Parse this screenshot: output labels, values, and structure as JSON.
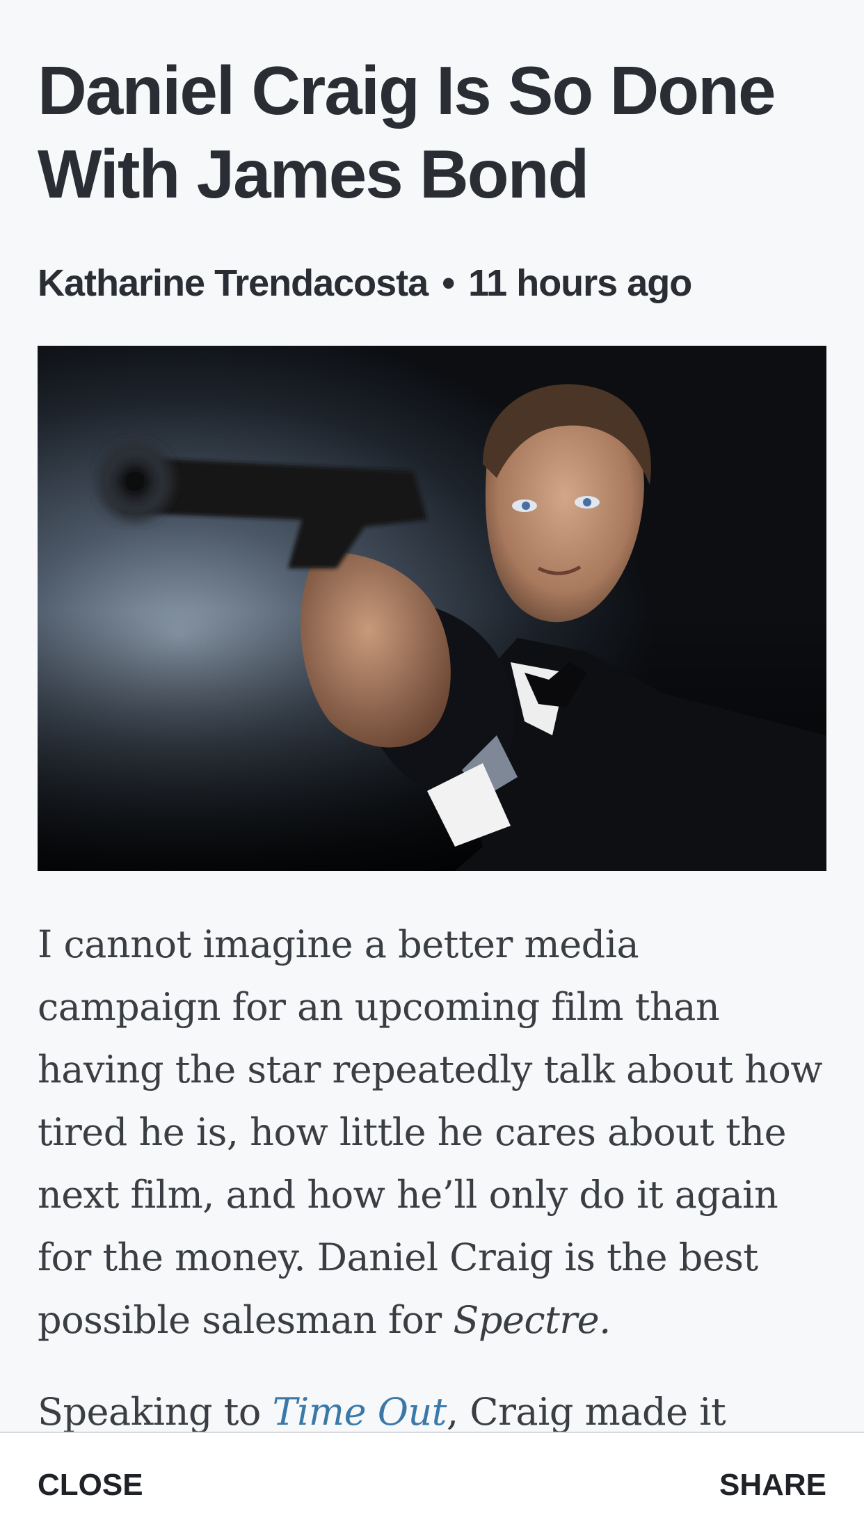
{
  "article": {
    "headline": "Daniel Craig Is So Done With James Bond",
    "author": "Katharine Trendacosta",
    "separator": "•",
    "published": "11 hours ago",
    "paragraphs": [
      {
        "segments": [
          {
            "text": "I cannot imagine a better media campaign for an upcoming film than having the star repeatedly talk about how tired he is, how little he cares about the next film, and how he’ll only do it again for the money. Daniel Craig is the best possible salesman for ",
            "style": "plain"
          },
          {
            "text": "Spectre.",
            "style": "italic"
          }
        ]
      },
      {
        "segments": [
          {
            "text": "Speaking to ",
            "style": "plain"
          },
          {
            "text": "Time Out",
            "style": "link"
          },
          {
            "text": ", Craig made it",
            "style": "plain"
          }
        ]
      }
    ]
  },
  "toolbar": {
    "close_label": "CLOSE",
    "share_label": "SHARE"
  },
  "colors": {
    "background": "#f7f8fa",
    "text": "#2a2d33",
    "link": "#3a78a8",
    "bar": "#ffffff"
  }
}
